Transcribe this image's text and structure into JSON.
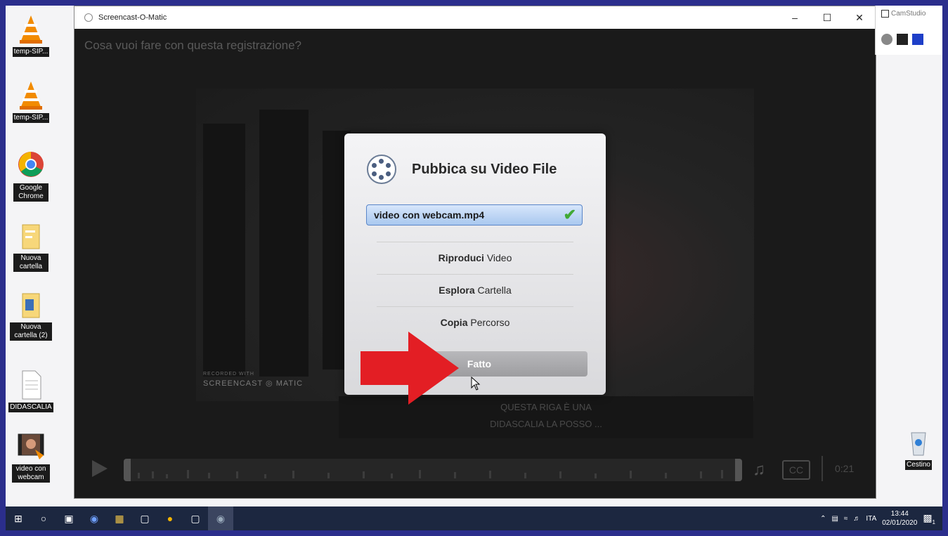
{
  "desktop": {
    "icons": [
      {
        "label": "temp-SIP...",
        "icon": "vlc-icon"
      },
      {
        "label": "temp-SIP...",
        "icon": "vlc-icon"
      },
      {
        "label": "Google Chrome",
        "icon": "chrome-icon"
      },
      {
        "label": "Nuova cartella",
        "icon": "folder-icon"
      },
      {
        "label": "Nuova cartella (2)",
        "icon": "folder-icon"
      },
      {
        "label": "DIDASCALIA",
        "icon": "text-file-icon"
      },
      {
        "label": "video con webcam",
        "icon": "video-file-icon"
      }
    ],
    "trash_label": "Cestino"
  },
  "window": {
    "title": "Screencast-O-Matic",
    "prompt": "Cosa vuoi fare con questa registrazione?",
    "watermark_small": "RECORDED WITH",
    "watermark_big": "SCREENCAST ◎ MATIC",
    "caption_line1": "QUESTA RIGA È UNA",
    "caption_line2": "DIDASCALIA LA POSSO ...",
    "player": {
      "cc": "CC",
      "time": "0:21"
    }
  },
  "dialog": {
    "title": "Pubbica su Video File",
    "filename": "video con webcam.mp4",
    "options": [
      {
        "bold": "Riproduci",
        "rest": " Video"
      },
      {
        "bold": "Esplora",
        "rest": " Cartella"
      },
      {
        "bold": "Copia",
        "rest": " Percorso"
      }
    ],
    "done_label": "Fatto"
  },
  "camstudio": {
    "title": "CamStudio"
  },
  "taskbar": {
    "lang": "ITA",
    "time": "13:44",
    "date": "02/01/2020",
    "notification_count": "1"
  },
  "colors": {
    "accent_arrow": "#e31e24",
    "file_highlight": "#a9c8ef",
    "check": "#41a934"
  }
}
